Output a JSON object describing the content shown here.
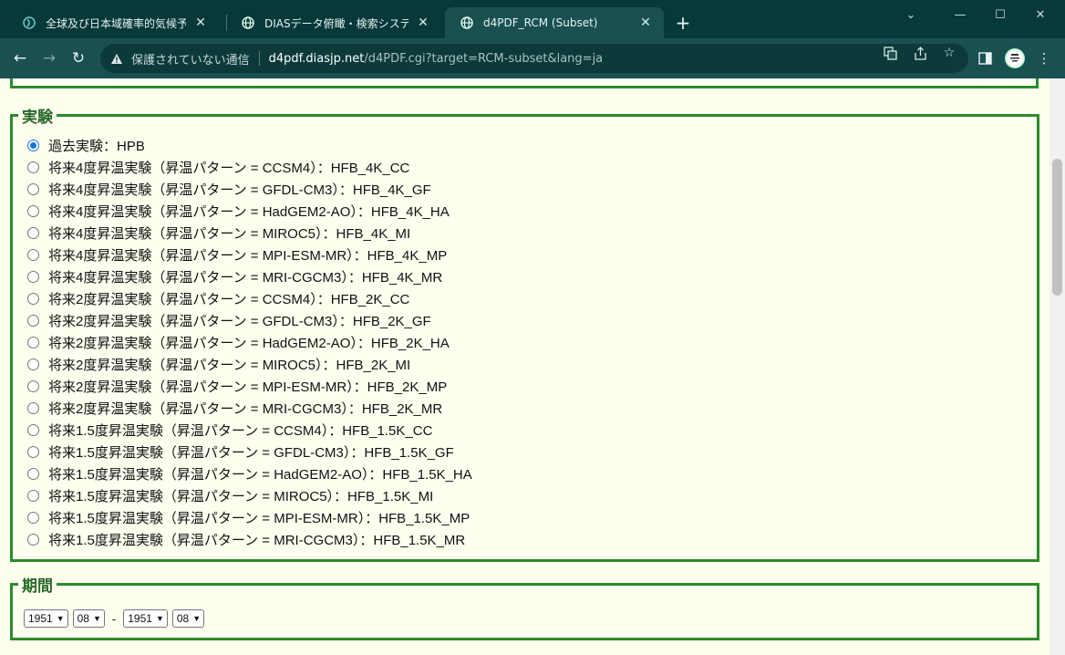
{
  "browser": {
    "tabs": [
      {
        "title": "全球及び日本域確率的気候予測デ",
        "active": false
      },
      {
        "title": "DIASデータ俯瞰・検索システム",
        "active": false
      },
      {
        "title": "d4PDF_RCM (Subset)",
        "active": true
      }
    ],
    "address": {
      "security": "保護されていない通信",
      "host": "d4pdf.diasjp.net",
      "path": "/d4PDF.cgi?target=RCM-subset&lang=ja"
    },
    "avatar_text": "avatar"
  },
  "experiment": {
    "legend": "実験",
    "options": [
      {
        "label": "過去実験：HPB",
        "checked": true
      },
      {
        "label": "将来4度昇温実験（昇温パターン = CCSM4）：HFB_4K_CC",
        "checked": false
      },
      {
        "label": "将来4度昇温実験（昇温パターン = GFDL-CM3）：HFB_4K_GF",
        "checked": false
      },
      {
        "label": "将来4度昇温実験（昇温パターン = HadGEM2-AO）：HFB_4K_HA",
        "checked": false
      },
      {
        "label": "将来4度昇温実験（昇温パターン = MIROC5）：HFB_4K_MI",
        "checked": false
      },
      {
        "label": "将来4度昇温実験（昇温パターン = MPI-ESM-MR）：HFB_4K_MP",
        "checked": false
      },
      {
        "label": "将来4度昇温実験（昇温パターン = MRI-CGCM3）：HFB_4K_MR",
        "checked": false
      },
      {
        "label": "将来2度昇温実験（昇温パターン = CCSM4）：HFB_2K_CC",
        "checked": false
      },
      {
        "label": "将来2度昇温実験（昇温パターン = GFDL-CM3）：HFB_2K_GF",
        "checked": false
      },
      {
        "label": "将来2度昇温実験（昇温パターン = HadGEM2-AO）：HFB_2K_HA",
        "checked": false
      },
      {
        "label": "将来2度昇温実験（昇温パターン = MIROC5）：HFB_2K_MI",
        "checked": false
      },
      {
        "label": "将来2度昇温実験（昇温パターン = MPI-ESM-MR）：HFB_2K_MP",
        "checked": false
      },
      {
        "label": "将来2度昇温実験（昇温パターン = MRI-CGCM3）：HFB_2K_MR",
        "checked": false
      },
      {
        "label": "将来1.5度昇温実験（昇温パターン = CCSM4）：HFB_1.5K_CC",
        "checked": false
      },
      {
        "label": "将来1.5度昇温実験（昇温パターン = GFDL-CM3）：HFB_1.5K_GF",
        "checked": false
      },
      {
        "label": "将来1.5度昇温実験（昇温パターン = HadGEM2-AO）：HFB_1.5K_HA",
        "checked": false
      },
      {
        "label": "将来1.5度昇温実験（昇温パターン = MIROC5）：HFB_1.5K_MI",
        "checked": false
      },
      {
        "label": "将来1.5度昇温実験（昇温パターン = MPI-ESM-MR）：HFB_1.5K_MP",
        "checked": false
      },
      {
        "label": "将来1.5度昇温実験（昇温パターン = MRI-CGCM3）：HFB_1.5K_MR",
        "checked": false
      }
    ]
  },
  "period": {
    "legend": "期間",
    "start_year": "1951",
    "start_month": "08",
    "separator": "-",
    "end_year": "1951",
    "end_month": "08"
  },
  "colors": {
    "border_green": "#2b8a2b",
    "page_bg": "#fffff0",
    "browser_frame": "#07393a"
  }
}
